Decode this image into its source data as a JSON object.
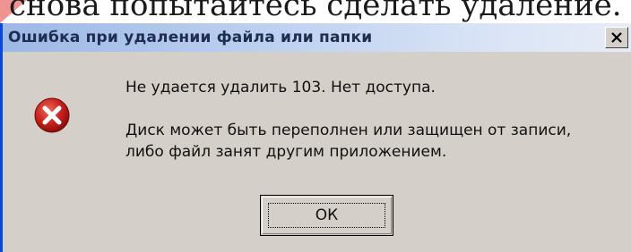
{
  "background_caption": "снова попытайтесь сделать удаление.",
  "dialog": {
    "title": "Ошибка при удалении файла или папки",
    "close_glyph": "×",
    "icon": "error-icon",
    "message_line1": "Не удается удалить 103. Нет доступа.",
    "message_line2": "Диск может быть переполнен или защищен от записи,",
    "message_line3": "либо файл занят другим приложением.",
    "ok_label": "ОК"
  },
  "colors": {
    "titlebar_start": "#9db8e6",
    "titlebar_end": "#e6ecf6",
    "dialog_bg": "#d4cfc8",
    "error_red": "#c8201e"
  }
}
